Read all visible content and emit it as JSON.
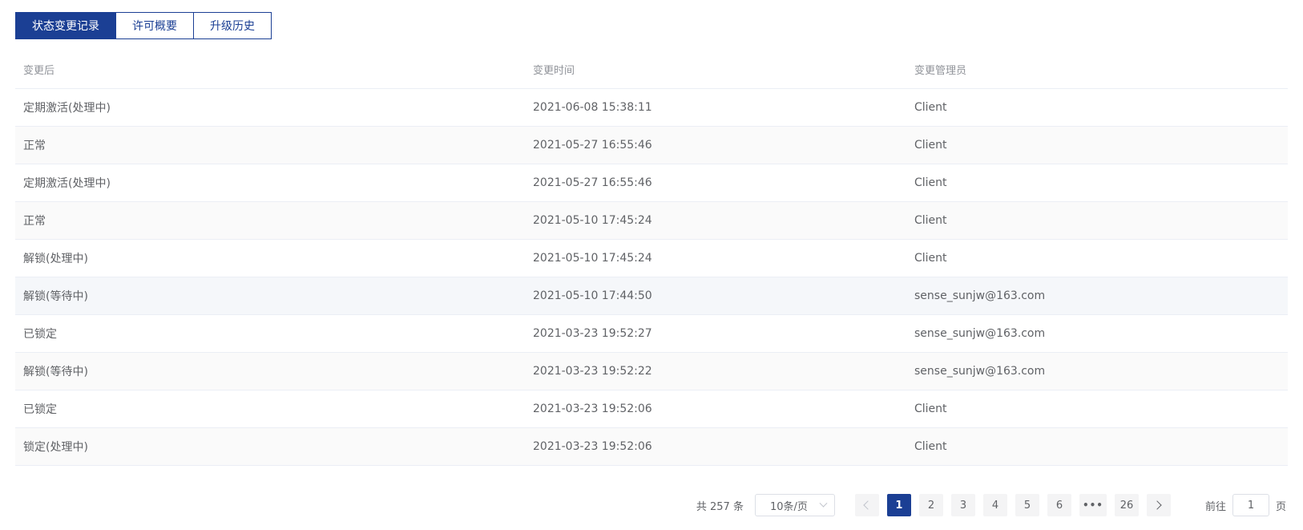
{
  "tabs": [
    {
      "label": "状态变更记录"
    },
    {
      "label": "许可概要"
    },
    {
      "label": "升级历史"
    }
  ],
  "table": {
    "headers": [
      "变更后",
      "变更时间",
      "变更管理员"
    ],
    "rows": [
      [
        "定期激活(处理中)",
        "2021-06-08 15:38:11",
        "Client"
      ],
      [
        "正常",
        "2021-05-27 16:55:46",
        "Client"
      ],
      [
        "定期激活(处理中)",
        "2021-05-27 16:55:46",
        "Client"
      ],
      [
        "正常",
        "2021-05-10 17:45:24",
        "Client"
      ],
      [
        "解锁(处理中)",
        "2021-05-10 17:45:24",
        "Client"
      ],
      [
        "解锁(等待中)",
        "2021-05-10 17:44:50",
        "sense_sunjw@163.com"
      ],
      [
        "已锁定",
        "2021-03-23 19:52:27",
        "sense_sunjw@163.com"
      ],
      [
        "解锁(等待中)",
        "2021-03-23 19:52:22",
        "sense_sunjw@163.com"
      ],
      [
        "已锁定",
        "2021-03-23 19:52:06",
        "Client"
      ],
      [
        "锁定(处理中)",
        "2021-03-23 19:52:06",
        "Client"
      ]
    ]
  },
  "pagination": {
    "total_label": "共 257 条",
    "page_size": "10条/页",
    "pages": [
      "1",
      "2",
      "3",
      "4",
      "5",
      "6",
      "•••",
      "26"
    ],
    "current": "1",
    "goto_label": "前往",
    "goto_value": "1",
    "page_suffix": "页"
  },
  "colors": {
    "accent": "#1b3f94",
    "border": "#ebeef5",
    "stripe": "#fafafa"
  }
}
